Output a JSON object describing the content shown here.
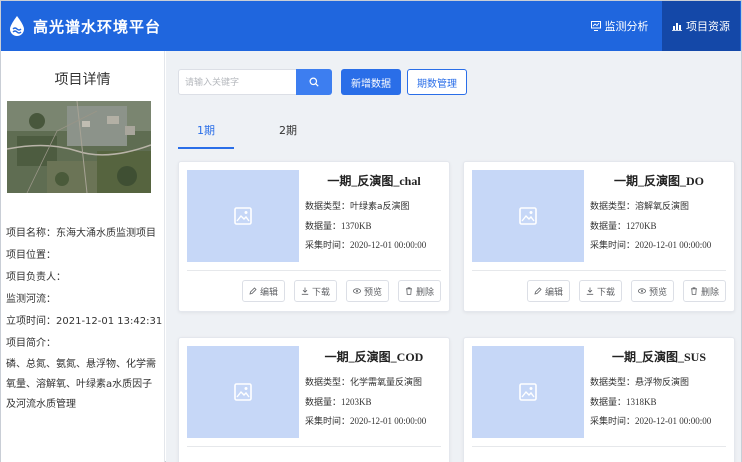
{
  "header": {
    "app_title": "高光谱水环境平台",
    "nav": [
      {
        "label": "监测分析",
        "icon": "monitor-icon"
      },
      {
        "label": "项目资源",
        "icon": "bar-chart-icon",
        "active": true
      }
    ]
  },
  "sidebar": {
    "title": "项目详情",
    "image": "satellite-map-image",
    "fields": {
      "name_label": "项目名称：",
      "name_value": "东海大涌水质监测项目",
      "location_label": "项目位置：",
      "owner_label": "项目负责人：",
      "river_label": "监测河流：",
      "time_label": "立项时间：",
      "time_value": "2021-12-01 13:42:31",
      "summary_label": "项目简介：",
      "summary_value": "磷、总氮、氨氮、悬浮物、化学需氧量、溶解氧、叶绿素a水质因子及河流水质管理"
    }
  },
  "toolbar": {
    "search_placeholder": "请输入关键字",
    "add_label": "新增数据",
    "period_label": "期数管理"
  },
  "tabs": [
    {
      "label": "1期",
      "active": true
    },
    {
      "label": "2期"
    }
  ],
  "cards": [
    {
      "title": "一期_反演图_chal",
      "type_label": "数据类型：",
      "type": "叶绿素a反演图",
      "size_label": "数据量：",
      "size": "1370KB",
      "time_label": "采集时间：",
      "time": "2020-12-01 00:00:00"
    },
    {
      "title": "一期_反演图_DO",
      "type_label": "数据类型：",
      "type": "溶解氧反演图",
      "size_label": "数据量：",
      "size": "1270KB",
      "time_label": "采集时间：",
      "time": "2020-12-01 00:00:00"
    },
    {
      "title": "一期_反演图_COD",
      "type_label": "数据类型：",
      "type": "化学需氧量反演图",
      "size_label": "数据量：",
      "size": "1203KB",
      "time_label": "采集时间：",
      "time": "2020-12-01 00:00:00"
    },
    {
      "title": "一期_反演图_SUS",
      "type_label": "数据类型：",
      "type": "悬浮物反演图",
      "size_label": "数据量：",
      "size": "1318KB",
      "time_label": "采集时间：",
      "time": "2020-12-01 00:00:00"
    }
  ],
  "card_actions": {
    "edit": "编辑",
    "download": "下载",
    "preview": "预览",
    "delete": "删除"
  },
  "colors": {
    "header_bg": "#1f66de",
    "nav_active_bg": "#1448a8",
    "primary": "#2a6ee8",
    "thumb_bg": "#c6d7f7"
  }
}
